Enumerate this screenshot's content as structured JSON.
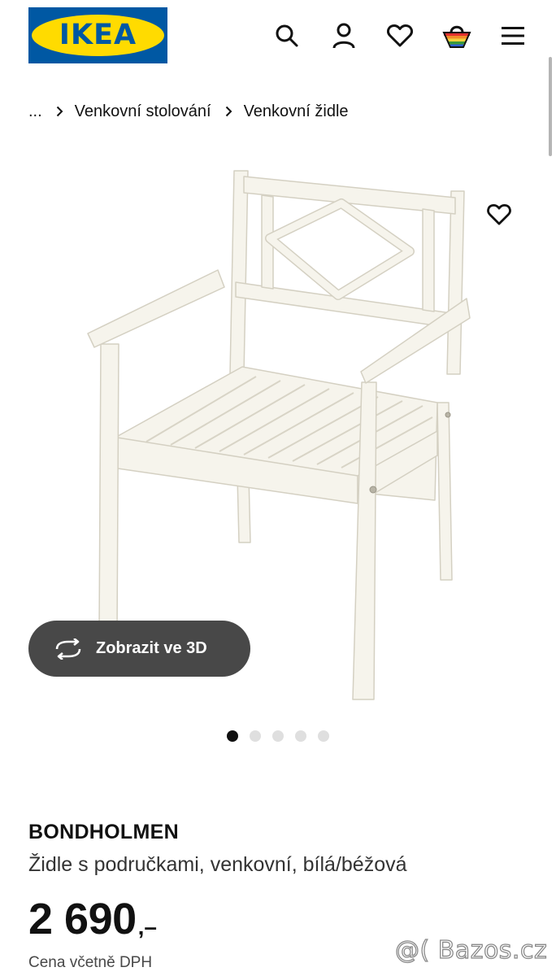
{
  "brand": {
    "logo_text": "IKEA",
    "colors": {
      "blue": "#0058a3",
      "yellow": "#ffdb00"
    }
  },
  "header": {
    "icons": [
      "search-icon",
      "account-icon",
      "heart-icon",
      "basket-icon",
      "menu-icon"
    ]
  },
  "breadcrumb": {
    "ellipsis": "...",
    "items": [
      {
        "label": "Venkovní stolování"
      },
      {
        "label": "Venkovní židle"
      }
    ]
  },
  "gallery": {
    "view_3d_label": "Zobrazit ve 3D",
    "dots_count": 5,
    "active_index": 0
  },
  "product": {
    "name": "BONDHOLMEN",
    "description": "Židle s područkami, venkovní, bílá/béžová",
    "price": "2 690",
    "price_suffix": ",–",
    "vat_note": "Cena včetně DPH"
  },
  "watermark": "@( Bazos.cz"
}
